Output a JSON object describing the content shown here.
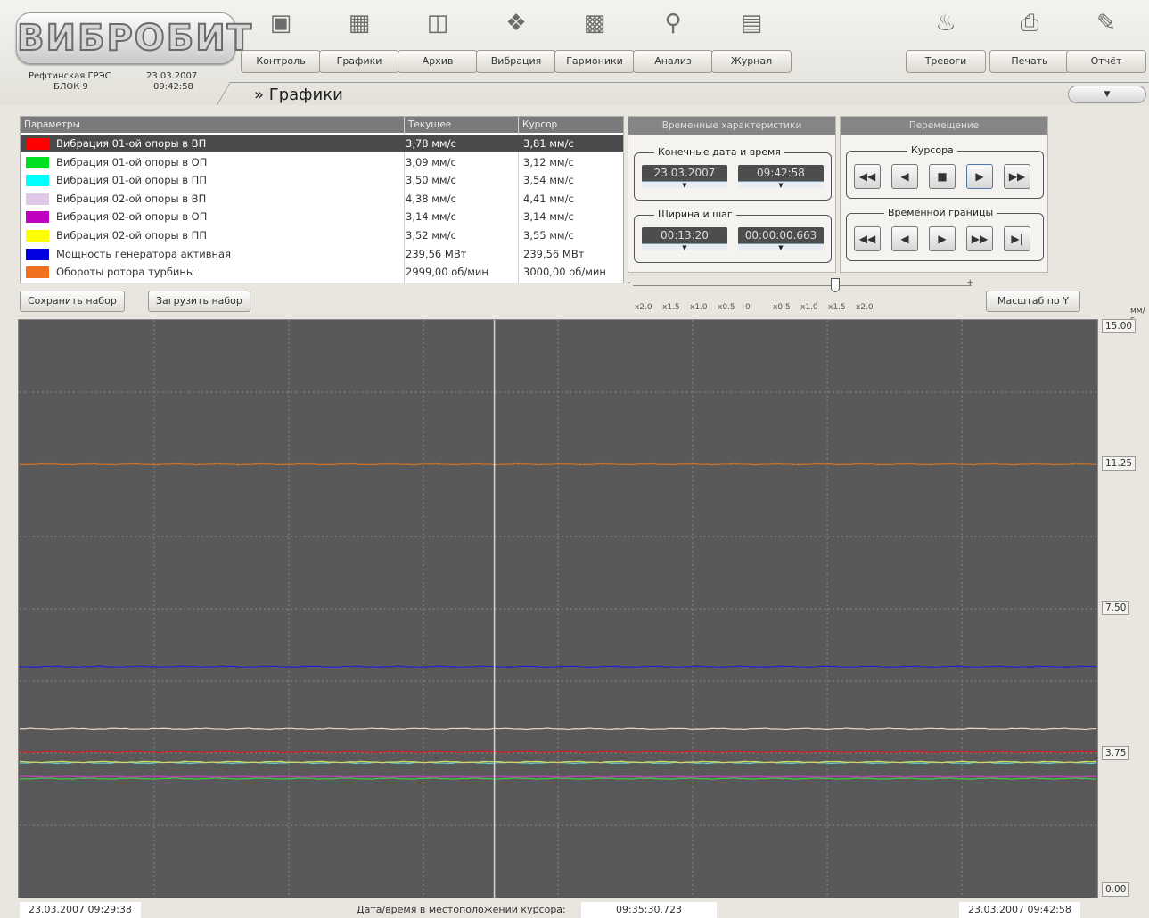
{
  "header": {
    "logo_text": "ВИБРОБИТ",
    "station": "Рефтинская ГРЭС",
    "block": "БЛОК 9",
    "date": "23.03.2007",
    "time": "09:42:58",
    "breadcrumb": "» Графики",
    "nav": [
      {
        "label": "Контроль",
        "icon": "monitor-icon"
      },
      {
        "label": "Графики",
        "icon": "chart-icon"
      },
      {
        "label": "Архив",
        "icon": "folder-icon"
      },
      {
        "label": "Вибрация",
        "icon": "vibration-icon"
      },
      {
        "label": "Гармоники",
        "icon": "harmonics-icon"
      },
      {
        "label": "Анализ",
        "icon": "magnifier-icon"
      },
      {
        "label": "Журнал",
        "icon": "book-icon"
      },
      {
        "label": "Тревоги",
        "icon": "bell-icon"
      },
      {
        "label": "Печать",
        "icon": "printer-icon"
      },
      {
        "label": "Отчёт",
        "icon": "report-icon"
      }
    ]
  },
  "params": {
    "col_name": "Параметры",
    "col_current": "Текущее",
    "col_cursor": "Курсор",
    "rows": [
      {
        "name": "Вибрация 01-ой опоры в ВП",
        "current": "3,78 мм/с",
        "cursor": "3,81 мм/с",
        "color": "#ff0000"
      },
      {
        "name": "Вибрация 01-ой опоры в ОП",
        "current": "3,09 мм/с",
        "cursor": "3,12 мм/с",
        "color": "#00e020"
      },
      {
        "name": "Вибрация 01-ой опоры в ПП",
        "current": "3,50 мм/с",
        "cursor": "3,54 мм/с",
        "color": "#00ffff"
      },
      {
        "name": "Вибрация 02-ой опоры в ВП",
        "current": "4,38 мм/с",
        "cursor": "4,41 мм/с",
        "color": "#e0c8e8"
      },
      {
        "name": "Вибрация 02-ой опоры в ОП",
        "current": "3,14 мм/с",
        "cursor": "3,14 мм/с",
        "color": "#c000c0"
      },
      {
        "name": "Вибрация 02-ой опоры в ПП",
        "current": "3,52 мм/с",
        "cursor": "3,55 мм/с",
        "color": "#ffff00"
      },
      {
        "name": "Мощность генератора активная",
        "current": "239,56 МВт",
        "cursor": "239,56 МВт",
        "color": "#0000e0"
      },
      {
        "name": "Обороты ротора турбины",
        "current": "2999,00 об/мин",
        "cursor": "3000,00 об/мин",
        "color": "#f07020"
      }
    ],
    "save_label": "Сохранить набор",
    "load_label": "Загрузить набор"
  },
  "time_panel": {
    "title": "Временные характеристики",
    "end_group": "Конечные дата и время",
    "end_date": "23.03.2007",
    "end_time": "09:42:58",
    "width_group": "Ширина и шаг",
    "width": "00:13:20",
    "step": "00:00:00.663"
  },
  "move_panel": {
    "title": "Перемещение",
    "cursor_group": "Курсора",
    "bound_group": "Временной границы"
  },
  "zoom": {
    "minus": "-",
    "plus": "+",
    "labels": [
      "x2.0",
      "x1.5",
      "x1.0",
      "x0.5",
      "0",
      "x0.5",
      "x1.0",
      "x1.5",
      "x2.0"
    ],
    "scale_label": "Масштаб по Y"
  },
  "chart_data": {
    "type": "line",
    "unit": "мм/с",
    "ylim": [
      0,
      15
    ],
    "yticks": [
      "15.00",
      "11.25",
      "7.50",
      "3.75",
      "0.00"
    ],
    "x_start": "23.03.2007 09:29:38",
    "x_end": "23.03.2007 09:42:58",
    "cursor_time": "09:35:30.723",
    "series": [
      {
        "name": "Вибрация 01-ой опоры в ВП",
        "color": "#d02020",
        "value": 3.78
      },
      {
        "name": "Вибрация 01-ой опоры в ОП",
        "color": "#40d040",
        "value": 3.09
      },
      {
        "name": "Вибрация 01-ой опоры в ПП",
        "color": "#60d0d0",
        "value": 3.5
      },
      {
        "name": "Вибрация 02-ой опоры в ВП",
        "color": "#e8d8c8",
        "value": 4.38
      },
      {
        "name": "Вибрация 02-ой опоры в ОП",
        "color": "#c040c0",
        "value": 3.14
      },
      {
        "name": "Вибрация 02-ой опоры в ПП",
        "color": "#d8d860",
        "value": 3.52
      },
      {
        "name": "Мощность генератора активная",
        "color": "#2020d0",
        "value": 6.0
      },
      {
        "name": "Обороты ротора турбины",
        "color": "#d07020",
        "value": 11.25
      }
    ]
  },
  "footer": {
    "start": "23.03.2007 09:29:38",
    "cursor_label": "Дата/время в местоположении курсора:",
    "cursor_value": "09:35:30.723",
    "end": "23.03.2007 09:42:58"
  }
}
